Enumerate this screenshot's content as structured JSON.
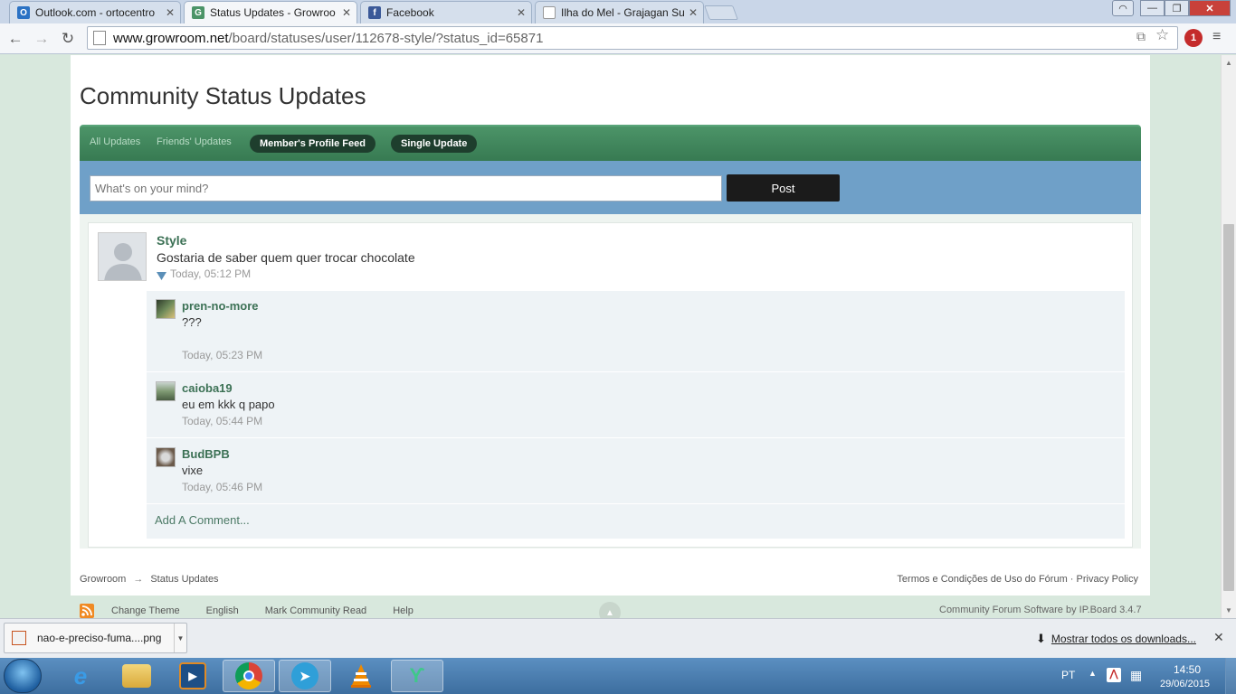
{
  "browser": {
    "tabs": [
      {
        "title": "Outlook.com - ortocentro",
        "icon": "outlook-icon",
        "active": false
      },
      {
        "title": "Status Updates - Growroo",
        "icon": "growroom-icon",
        "active": true
      },
      {
        "title": "Facebook",
        "icon": "facebook-icon",
        "active": false
      },
      {
        "title": "Ilha do Mel - Grajagan Sur",
        "icon": "page-icon",
        "active": false
      }
    ],
    "url_host": "www.growroom.net",
    "url_path": "/board/statuses/user/112678-style/?status_id=65871",
    "extension_badge": "1"
  },
  "page": {
    "title": "Community Status Updates",
    "filter_tabs": {
      "all": "All Updates",
      "friends": "Friends' Updates",
      "profile": "Member's Profile Feed",
      "single": "Single Update"
    },
    "status_placeholder": "What's on your mind?",
    "post_label": "Post",
    "status": {
      "author": "Style",
      "text": "Gostaria de saber quem quer trocar chocolate",
      "time": "Today, 05:12 PM"
    },
    "comments": [
      {
        "author": "pren-no-more",
        "text": "???",
        "time": "Today, 05:23 PM"
      },
      {
        "author": "caioba19",
        "text": "eu em kkk q papo",
        "time": "Today, 05:44 PM"
      },
      {
        "author": "BudBPB",
        "text": "vixe",
        "time": "Today, 05:46 PM"
      }
    ],
    "add_comment": "Add A Comment...",
    "breadcrumb": {
      "home": "Growroom",
      "arrow": "→",
      "current": "Status Updates"
    },
    "footer_links": {
      "terms": "Termos e Condições de Uso do Fórum",
      "sep": "·",
      "privacy": "Privacy Policy"
    },
    "bottom_links": [
      "Change Theme",
      "English",
      "Mark Community Read",
      "Help"
    ],
    "powered_by": "Community Forum Software by IP.Board 3.4.7"
  },
  "downloads": {
    "file": "nao-e-preciso-fuma....png",
    "show_all": "Mostrar todos os downloads..."
  },
  "taskbar": {
    "language": "PT",
    "time": "14:50",
    "date": "29/06/2015"
  },
  "colors": {
    "accent_green": "#3c7155",
    "tab_bar_green": "#4c9468",
    "status_box_blue": "#6fa0c8"
  }
}
